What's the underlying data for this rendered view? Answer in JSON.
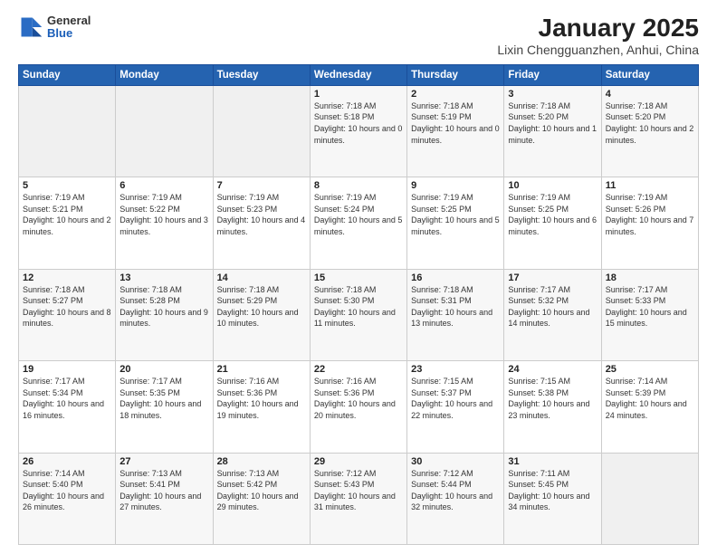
{
  "header": {
    "logo": {
      "line1": "General",
      "line2": "Blue"
    },
    "title": "January 2025",
    "subtitle": "Lixin Chengguanzhen, Anhui, China"
  },
  "weekdays": [
    "Sunday",
    "Monday",
    "Tuesday",
    "Wednesday",
    "Thursday",
    "Friday",
    "Saturday"
  ],
  "weeks": [
    [
      {
        "day": "",
        "sunrise": "",
        "sunset": "",
        "daylight": ""
      },
      {
        "day": "",
        "sunrise": "",
        "sunset": "",
        "daylight": ""
      },
      {
        "day": "",
        "sunrise": "",
        "sunset": "",
        "daylight": ""
      },
      {
        "day": "1",
        "sunrise": "Sunrise: 7:18 AM",
        "sunset": "Sunset: 5:18 PM",
        "daylight": "Daylight: 10 hours and 0 minutes."
      },
      {
        "day": "2",
        "sunrise": "Sunrise: 7:18 AM",
        "sunset": "Sunset: 5:19 PM",
        "daylight": "Daylight: 10 hours and 0 minutes."
      },
      {
        "day": "3",
        "sunrise": "Sunrise: 7:18 AM",
        "sunset": "Sunset: 5:20 PM",
        "daylight": "Daylight: 10 hours and 1 minute."
      },
      {
        "day": "4",
        "sunrise": "Sunrise: 7:18 AM",
        "sunset": "Sunset: 5:20 PM",
        "daylight": "Daylight: 10 hours and 2 minutes."
      }
    ],
    [
      {
        "day": "5",
        "sunrise": "Sunrise: 7:19 AM",
        "sunset": "Sunset: 5:21 PM",
        "daylight": "Daylight: 10 hours and 2 minutes."
      },
      {
        "day": "6",
        "sunrise": "Sunrise: 7:19 AM",
        "sunset": "Sunset: 5:22 PM",
        "daylight": "Daylight: 10 hours and 3 minutes."
      },
      {
        "day": "7",
        "sunrise": "Sunrise: 7:19 AM",
        "sunset": "Sunset: 5:23 PM",
        "daylight": "Daylight: 10 hours and 4 minutes."
      },
      {
        "day": "8",
        "sunrise": "Sunrise: 7:19 AM",
        "sunset": "Sunset: 5:24 PM",
        "daylight": "Daylight: 10 hours and 5 minutes."
      },
      {
        "day": "9",
        "sunrise": "Sunrise: 7:19 AM",
        "sunset": "Sunset: 5:25 PM",
        "daylight": "Daylight: 10 hours and 5 minutes."
      },
      {
        "day": "10",
        "sunrise": "Sunrise: 7:19 AM",
        "sunset": "Sunset: 5:25 PM",
        "daylight": "Daylight: 10 hours and 6 minutes."
      },
      {
        "day": "11",
        "sunrise": "Sunrise: 7:19 AM",
        "sunset": "Sunset: 5:26 PM",
        "daylight": "Daylight: 10 hours and 7 minutes."
      }
    ],
    [
      {
        "day": "12",
        "sunrise": "Sunrise: 7:18 AM",
        "sunset": "Sunset: 5:27 PM",
        "daylight": "Daylight: 10 hours and 8 minutes."
      },
      {
        "day": "13",
        "sunrise": "Sunrise: 7:18 AM",
        "sunset": "Sunset: 5:28 PM",
        "daylight": "Daylight: 10 hours and 9 minutes."
      },
      {
        "day": "14",
        "sunrise": "Sunrise: 7:18 AM",
        "sunset": "Sunset: 5:29 PM",
        "daylight": "Daylight: 10 hours and 10 minutes."
      },
      {
        "day": "15",
        "sunrise": "Sunrise: 7:18 AM",
        "sunset": "Sunset: 5:30 PM",
        "daylight": "Daylight: 10 hours and 11 minutes."
      },
      {
        "day": "16",
        "sunrise": "Sunrise: 7:18 AM",
        "sunset": "Sunset: 5:31 PM",
        "daylight": "Daylight: 10 hours and 13 minutes."
      },
      {
        "day": "17",
        "sunrise": "Sunrise: 7:17 AM",
        "sunset": "Sunset: 5:32 PM",
        "daylight": "Daylight: 10 hours and 14 minutes."
      },
      {
        "day": "18",
        "sunrise": "Sunrise: 7:17 AM",
        "sunset": "Sunset: 5:33 PM",
        "daylight": "Daylight: 10 hours and 15 minutes."
      }
    ],
    [
      {
        "day": "19",
        "sunrise": "Sunrise: 7:17 AM",
        "sunset": "Sunset: 5:34 PM",
        "daylight": "Daylight: 10 hours and 16 minutes."
      },
      {
        "day": "20",
        "sunrise": "Sunrise: 7:17 AM",
        "sunset": "Sunset: 5:35 PM",
        "daylight": "Daylight: 10 hours and 18 minutes."
      },
      {
        "day": "21",
        "sunrise": "Sunrise: 7:16 AM",
        "sunset": "Sunset: 5:36 PM",
        "daylight": "Daylight: 10 hours and 19 minutes."
      },
      {
        "day": "22",
        "sunrise": "Sunrise: 7:16 AM",
        "sunset": "Sunset: 5:36 PM",
        "daylight": "Daylight: 10 hours and 20 minutes."
      },
      {
        "day": "23",
        "sunrise": "Sunrise: 7:15 AM",
        "sunset": "Sunset: 5:37 PM",
        "daylight": "Daylight: 10 hours and 22 minutes."
      },
      {
        "day": "24",
        "sunrise": "Sunrise: 7:15 AM",
        "sunset": "Sunset: 5:38 PM",
        "daylight": "Daylight: 10 hours and 23 minutes."
      },
      {
        "day": "25",
        "sunrise": "Sunrise: 7:14 AM",
        "sunset": "Sunset: 5:39 PM",
        "daylight": "Daylight: 10 hours and 24 minutes."
      }
    ],
    [
      {
        "day": "26",
        "sunrise": "Sunrise: 7:14 AM",
        "sunset": "Sunset: 5:40 PM",
        "daylight": "Daylight: 10 hours and 26 minutes."
      },
      {
        "day": "27",
        "sunrise": "Sunrise: 7:13 AM",
        "sunset": "Sunset: 5:41 PM",
        "daylight": "Daylight: 10 hours and 27 minutes."
      },
      {
        "day": "28",
        "sunrise": "Sunrise: 7:13 AM",
        "sunset": "Sunset: 5:42 PM",
        "daylight": "Daylight: 10 hours and 29 minutes."
      },
      {
        "day": "29",
        "sunrise": "Sunrise: 7:12 AM",
        "sunset": "Sunset: 5:43 PM",
        "daylight": "Daylight: 10 hours and 31 minutes."
      },
      {
        "day": "30",
        "sunrise": "Sunrise: 7:12 AM",
        "sunset": "Sunset: 5:44 PM",
        "daylight": "Daylight: 10 hours and 32 minutes."
      },
      {
        "day": "31",
        "sunrise": "Sunrise: 7:11 AM",
        "sunset": "Sunset: 5:45 PM",
        "daylight": "Daylight: 10 hours and 34 minutes."
      },
      {
        "day": "",
        "sunrise": "",
        "sunset": "",
        "daylight": ""
      }
    ]
  ]
}
